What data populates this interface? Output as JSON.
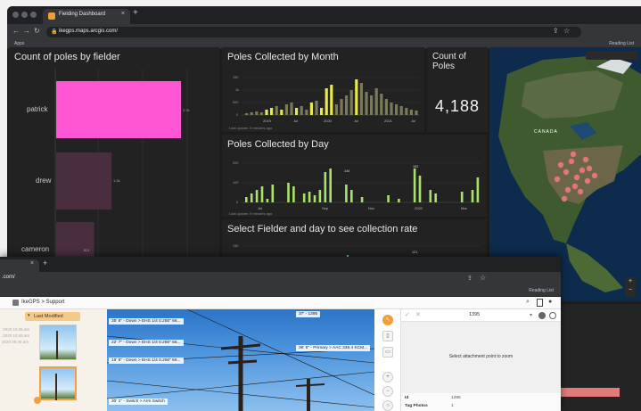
{
  "back_window": {
    "tab_title": "Fielding Dashboard",
    "tab_close": "×",
    "new_tab": "+",
    "url": "ikegps.maps.arcgis.com/",
    "bookmark_left": "Apps",
    "bookmark_right": "Reading List"
  },
  "panels": {
    "fielder": {
      "title": "Count of poles by fielder",
      "labels": [
        "patrick",
        "drew",
        "cameron"
      ],
      "values_text": [
        "2.7k",
        "1.2k",
        "821"
      ],
      "colors": [
        "#ff55d2",
        "#4a2e3f",
        "#4a2e3f"
      ]
    },
    "month": {
      "title": "Poles Collected by Month",
      "yticks": [
        "150",
        "1k",
        "500",
        "0"
      ],
      "xticks": [
        "2019",
        "Jul",
        "2020",
        "Jul",
        "2021",
        "Jul"
      ],
      "note": "Last update: 9 minutes ago"
    },
    "count": {
      "title": "Count of Poles",
      "value": "4,188"
    },
    "day": {
      "title": "Poles Collected by Day",
      "yticks": [
        "200",
        "100",
        "0"
      ],
      "xticks": [
        "Jul",
        "Sep",
        "Nov",
        "2020",
        "Mar"
      ],
      "peak_label": "144",
      "peak2_label": "152",
      "note": "Last update: 9 minutes ago"
    },
    "select": {
      "title": "Select Fielder and day to see collection rate",
      "yticks": [
        "150",
        "100"
      ],
      "peak_label": "121"
    },
    "map": {
      "country_label": "CANADA",
      "accent": "#f07878"
    }
  },
  "front_window": {
    "tab_close": "×",
    "new_tab": "+",
    "url": ".com/",
    "bookmark_right": "Reading List",
    "app_title": "IkeGPS > Support",
    "sort_label": "Last Modified",
    "stamps": [
      ".2020 10:45 am",
      ".2020 10:45 am",
      "2020 09:45 am"
    ],
    "photo_labels": [
      "35' 8\" - Down > EHS 1/4 0.250\" 66...",
      "37' - 1395",
      "22' 7\" - Down > EHS 1/4 0.250\" 66...",
      "36' 5\" - Primary > AAC 336.4 KCM...",
      "16' 6\" - Down > EHS 1/4 0.250\" 66...",
      "30' 1\" - Switch > Arm Switch"
    ],
    "detail": {
      "id": "1395",
      "message": "Select attachment point to zoom",
      "field_label": "Id",
      "field_value": "1395",
      "field2_label": "Tag Photos",
      "field2_value": "1"
    }
  }
}
